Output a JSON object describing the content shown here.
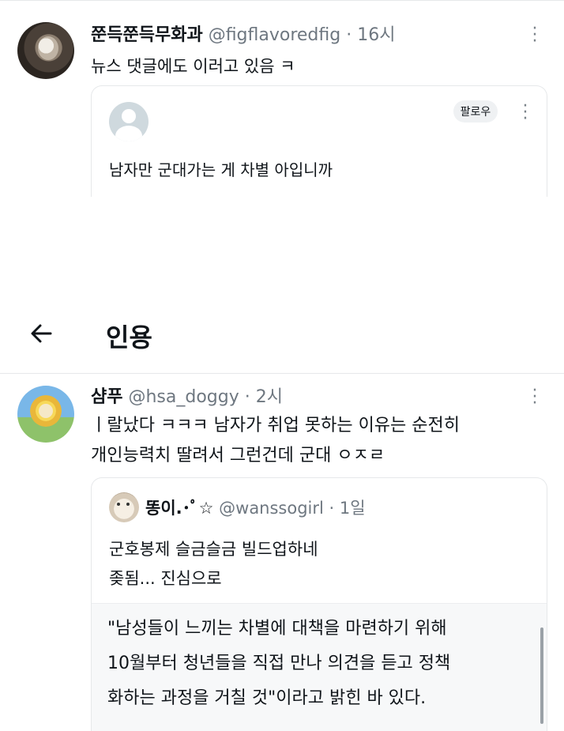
{
  "tweet1": {
    "display_name": "쭌득쭌득무화과",
    "handle": "@figflavoredfig",
    "separator": "·",
    "time": "16시",
    "text": "뉴스 댓글에도 이러고 있음 ㅋ",
    "embedded": {
      "follow_label": "팔로우",
      "text": "남자만 군대가는 게 차별 아입니까"
    }
  },
  "quote_page": {
    "title": "인용"
  },
  "tweet2": {
    "display_name": "샴푸",
    "handle": "@hsa_doggy",
    "separator": "·",
    "time": "2시",
    "lines": [
      "ㅣ랄났다 ㅋㅋㅋ 남자가 취업 못하는 이유는 순전히",
      "개인능력치 딸려서 그런건데 군대 ㅇㅈㄹ"
    ],
    "quoted": {
      "display_name": "똥이.･ﾟ☆",
      "handle": "@wanssogirl",
      "separator": "·",
      "time": "1일",
      "lines": [
        "군호봉제 슬금슬금 빌드업하네",
        "좆됨... 진심으로"
      ],
      "excerpt_lines": [
        "\"남성들이 느끼는 차별에 대책을 마련하기 위해",
        "10월부터 청년들을 직접 만나 의견을 듣고 정책",
        "화하는 과정을 거칠 것\"이라고 밝힌 바 있다."
      ]
    }
  },
  "icons": {
    "more": "more-vertical-icon",
    "back": "back-arrow-icon"
  }
}
